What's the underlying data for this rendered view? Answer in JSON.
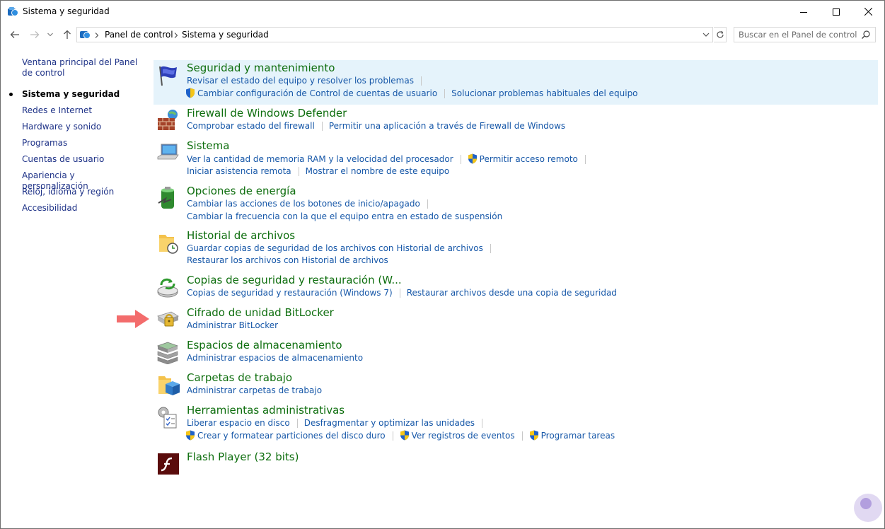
{
  "window": {
    "title": "Sistema y seguridad"
  },
  "address": {
    "crumbs": [
      "Panel de control",
      "Sistema y seguridad"
    ],
    "search_placeholder": "Buscar en el Panel de control"
  },
  "leftnav": {
    "home": "Ventana principal del Panel de control",
    "items": [
      {
        "label": "Sistema y seguridad",
        "current": true
      },
      {
        "label": "Redes e Internet"
      },
      {
        "label": "Hardware y sonido"
      },
      {
        "label": "Programas"
      },
      {
        "label": "Cuentas de usuario"
      },
      {
        "label": "Apariencia y personalización"
      },
      {
        "label": "Reloj, idioma y región"
      },
      {
        "label": "Accesibilidad"
      }
    ]
  },
  "categories": [
    {
      "title": "Seguridad y mantenimiento",
      "icon": "security-flag-icon",
      "lines": [
        [
          "Revisar el estado del equipo y resolver los problemas"
        ],
        [
          "Cambiar configuración de Control de cuentas de usuario",
          "Solucionar problemas habituales del equipo"
        ]
      ]
    },
    {
      "title": "Firewall de Windows Defender",
      "icon": "firewall-icon",
      "lines": [
        [
          "Comprobar estado del firewall",
          "Permitir una aplicación a través de Firewall de Windows"
        ]
      ]
    },
    {
      "title": "Sistema",
      "icon": "system-computer-icon",
      "lines": [
        [
          "Ver la cantidad de memoria RAM y la velocidad del procesador",
          "Permitir acceso remoto"
        ],
        [
          "Iniciar asistencia remota",
          "Mostrar el nombre de este equipo"
        ]
      ]
    },
    {
      "title": "Opciones de energía",
      "icon": "power-battery-icon",
      "lines": [
        [
          "Cambiar las acciones de los botones de inicio/apagado"
        ],
        [
          "Cambiar la frecuencia con la que el equipo entra en estado de suspensión"
        ]
      ]
    },
    {
      "title": "Historial de archivos",
      "icon": "file-history-icon",
      "lines": [
        [
          "Guardar copias de seguridad de los archivos con Historial de archivos"
        ],
        [
          "Restaurar los archivos con Historial de archivos"
        ]
      ]
    },
    {
      "title": "Copias de seguridad y restauración (W...",
      "icon": "backup-restore-icon",
      "lines": [
        [
          "Copias de seguridad y restauración (Windows 7)",
          "Restaurar archivos desde una copia de seguridad"
        ]
      ]
    },
    {
      "title": "Cifrado de unidad BitLocker",
      "icon": "bitlocker-icon",
      "lines": [
        [
          "Administrar BitLocker"
        ]
      ]
    },
    {
      "title": "Espacios de almacenamiento",
      "icon": "storage-spaces-icon",
      "lines": [
        [
          "Administrar espacios de almacenamiento"
        ]
      ]
    },
    {
      "title": "Carpetas de trabajo",
      "icon": "work-folders-icon",
      "lines": [
        [
          "Administrar carpetas de trabajo"
        ]
      ]
    },
    {
      "title": "Herramientas administrativas",
      "icon": "admin-tools-icon",
      "lines": [
        [
          "Liberar espacio en disco",
          "Desfragmentar y optimizar las unidades"
        ],
        [
          "Crear y formatear particiones del disco duro",
          "Ver registros de eventos",
          "Programar tareas"
        ]
      ]
    },
    {
      "title": "Flash Player (32 bits)",
      "icon": "flash-player-icon",
      "lines": []
    }
  ],
  "colors": {
    "title_green": "#0e6e0e",
    "link_blue": "#1657a8",
    "highlight": "#e5f3fb",
    "arrow": "#f36c6c"
  }
}
